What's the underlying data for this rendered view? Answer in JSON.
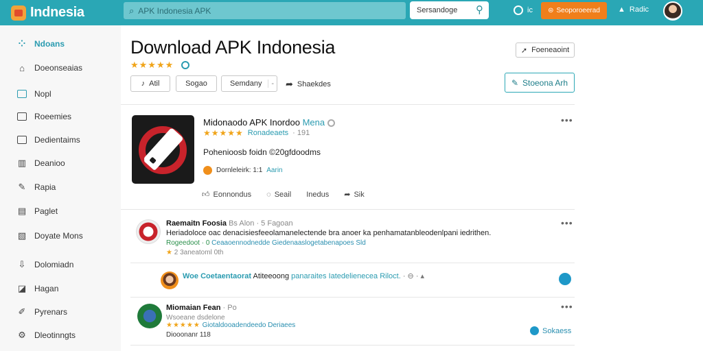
{
  "topbar": {
    "logo_text": "Indnesia",
    "search_placeholder": "APK Indonesia APK",
    "search_button": "Sersandoge",
    "help_label": "ic",
    "promo_label": "Seoporoeerad",
    "account_label": "Radic"
  },
  "sidebar": {
    "items": [
      {
        "label": "Ndoans",
        "icon": "grid-icon"
      },
      {
        "label": "Doeonseaias",
        "icon": "home-icon"
      },
      {
        "label": "Nopl",
        "icon": "square-icon"
      },
      {
        "label": "Roeemies",
        "icon": "box-icon"
      },
      {
        "label": "Dedientaims",
        "icon": "folder-icon"
      },
      {
        "label": "Deanioo",
        "icon": "chart-icon"
      },
      {
        "label": "Rapia",
        "icon": "edit-icon"
      },
      {
        "label": "Paglet",
        "icon": "page-icon"
      },
      {
        "label": "Doyate Mons",
        "icon": "clipboard-icon"
      },
      {
        "label": "Dolomiadn",
        "icon": "download-icon"
      },
      {
        "label": "Hagan",
        "icon": "tag-icon"
      },
      {
        "label": "Pyrenars",
        "icon": "pen-icon"
      },
      {
        "label": "Dleotinngts",
        "icon": "settings-icon"
      }
    ]
  },
  "header": {
    "title": "Download APK Indonesia",
    "stars": "★★★★★",
    "report_button": "Foeneaoint",
    "preview_button": "Stoeona Arh"
  },
  "filters": {
    "all": "Atil",
    "second": "Sogao",
    "dropdown": "Semdany",
    "share": "Shaekdes"
  },
  "app": {
    "title_prefix": "Midonaodo APK Inordoo ",
    "title_highlight": "Mena",
    "stars": "★★★★★",
    "rating_label": "Ronadeaets",
    "rating_count": "191",
    "description": "Pohenioosb foidn ©20gfdoodms",
    "meta_text": "Dornleleirk: 1:1",
    "meta_link": "Aarin",
    "actions": [
      "Eonnondus",
      "Seail",
      "Inedus",
      "Sik"
    ]
  },
  "comments": [
    {
      "name": "Raemaitn Foosia",
      "name_suffix": "Bs Alon · 5 Fagoan",
      "text": "Heriadoloce oac denacisiesfeeolamanelectende bra anoer ka penhamatanbleodenlpani iedrithen.",
      "link_green": "Rogeedoot · 0",
      "link_blue": "Ceaaoennodnedde Giedenaaslogetabenapoes Sld",
      "stats": "2 3aneatoml 0th"
    },
    {
      "reply_strong": "Woe Coetaentaorat",
      "reply_dark": " Atiteeoong ",
      "reply_rest": "panaraites Iatedelienecea Riloct."
    },
    {
      "name": "Miomaian Fean",
      "name_suffix": "· Po",
      "sub": "Wsoeane dsdelone",
      "stars": "★★★★★",
      "link_blue": "Giotaldooadendeedo Deriaees",
      "stats": "Diooonanr 118",
      "solution": "Sokaess"
    }
  ]
}
